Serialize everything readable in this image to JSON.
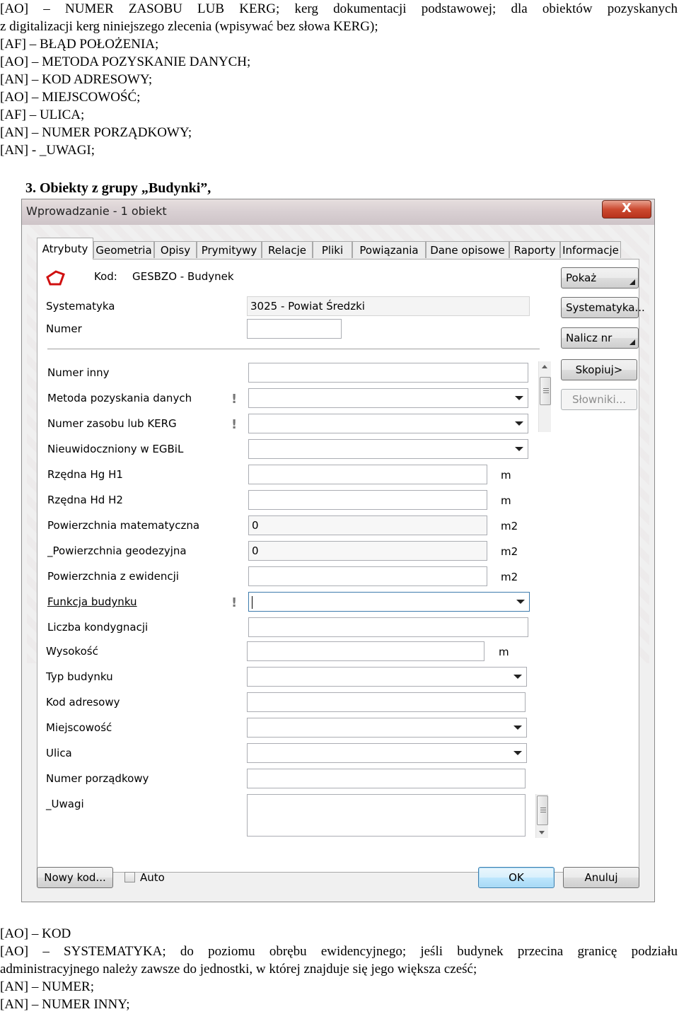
{
  "doc_top_lines": [
    "[AO] – NUMER ZASOBU LUB KERG; kerg dokumentacji podstawowej; dla obiektów pozyskanych",
    "z digitalizacji kerg niniejszego zlecenia (wpisywać bez słowa KERG);",
    "[AF] – BŁĄD POŁOŻENIA;",
    "[AO] – METODA POZYSKANIE DANYCH;",
    "[AN] – KOD ADRESOWY;",
    "[AO] – MIEJSCOWOŚĆ;",
    "[AF] – ULICA;",
    "[AN] – NUMER PORZĄDKOWY;",
    "[AN] - _UWAGI;"
  ],
  "section_heading": "3.  Obiekty z grupy „Budynki”,",
  "dialog": {
    "title": "Wprowadzanie - 1 obiekt",
    "close_glyph": "X",
    "tabs": [
      "Atrybuty",
      "Geometria",
      "Opisy",
      "Prymitywy",
      "Relacje",
      "Pliki",
      "Powiązania",
      "Dane opisowe",
      "Raporty",
      "Informacje"
    ],
    "active_tab": "Atrybuty",
    "kod_label": "Kod:",
    "kod_value": "GESBZO - Budynek",
    "systematyka_label": "Systematyka",
    "systematyka_value": "3025 - Powiat Średzki",
    "numer_label": "Numer",
    "numer_value": "",
    "fields": {
      "numer_inny": {
        "label": "Numer inny",
        "value": ""
      },
      "metoda": {
        "label": "Metoda pozyskania danych",
        "value": ""
      },
      "numer_zasobu": {
        "label": "Numer zasobu lub KERG",
        "value": ""
      },
      "nieuwidoczniony": {
        "label": "Nieuwidoczniony w EGBiL",
        "value": ""
      },
      "rzedna_h1": {
        "label": "Rzędna Hg H1",
        "value": "",
        "unit": "m"
      },
      "rzedna_h2": {
        "label": "Rzędna Hd H2",
        "value": "",
        "unit": "m"
      },
      "pow_mat": {
        "label": "Powierzchnia matematyczna",
        "value": "0",
        "unit": "m2"
      },
      "pow_geo": {
        "label": "_Powierzchnia geodezyjna",
        "value": "0",
        "unit": "m2"
      },
      "pow_ewid": {
        "label": "Powierzchnia z ewidencji",
        "value": "",
        "unit": "m2"
      },
      "funkcja": {
        "label": "Funkcja budynku",
        "value": ""
      },
      "kondygnacje": {
        "label": "Liczba kondygnacji",
        "value": ""
      },
      "wysokosc": {
        "label": "Wysokość",
        "value": "",
        "unit": "m"
      },
      "typ": {
        "label": "Typ budynku",
        "value": ""
      },
      "kod_adresowy": {
        "label": "Kod adresowy",
        "value": ""
      },
      "miejscowosc": {
        "label": "Miejscowość",
        "value": ""
      },
      "ulica": {
        "label": "Ulica",
        "value": ""
      },
      "numer_porzadkowy": {
        "label": "Numer porządkowy",
        "value": ""
      },
      "uwagi": {
        "label": "_Uwagi",
        "value": ""
      }
    },
    "side_buttons": {
      "pokaz": "Pokaż",
      "systematyka": "Systematyka...",
      "nalicz": "Nalicz nr",
      "skopiuj": "Skopiuj>",
      "slowniki": "Słowniki..."
    },
    "bottom": {
      "nowy_kod": "Nowy kod...",
      "auto_label": "Auto",
      "auto_checked": false,
      "ok": "OK",
      "anuluj": "Anuluj"
    }
  },
  "doc_bottom": {
    "line1": "[AO] – KOD",
    "line2": "[AO] – SYSTEMATYKA; do poziomu obrębu ewidencyjnego; jeśli budynek przecina granicę podziału",
    "line3": "administracyjnego należy zawsze do jednostki, w której znajduje się jego większa cześć;",
    "line4": "[AN] – NUMER;",
    "line5": "[AN] – NUMER INNY;"
  }
}
